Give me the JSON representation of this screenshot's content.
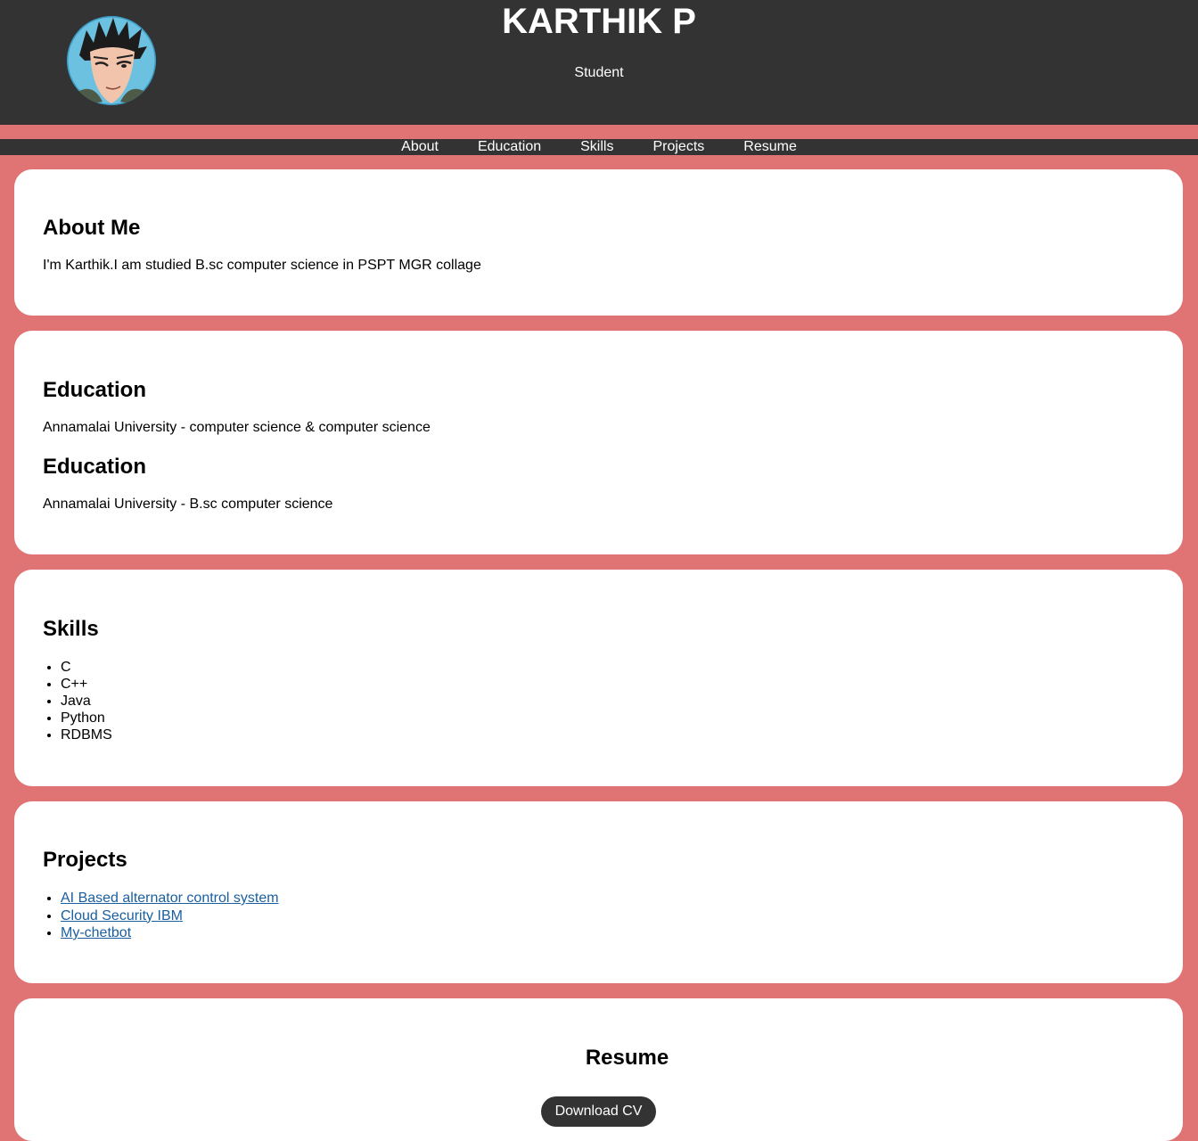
{
  "header": {
    "name": "KARTHIK P",
    "role": "Student",
    "avatar_icon": "anime-character-avatar"
  },
  "nav": {
    "items": [
      "About",
      "Education",
      "Skills",
      "Projects",
      "Resume"
    ]
  },
  "about": {
    "heading": "About Me",
    "text": "I'm Karthik.I am studied B.sc computer science in PSPT MGR collage"
  },
  "education": [
    {
      "heading": "Education",
      "text": "Annamalai University - computer science & computer science"
    },
    {
      "heading": "Education",
      "text": "Annamalai University - B.sc computer science"
    }
  ],
  "skills": {
    "heading": "Skills",
    "items": [
      "C",
      "C++",
      "Java",
      "Python",
      "RDBMS"
    ]
  },
  "projects": {
    "heading": "Projects",
    "items": [
      "AI Based alternator control system",
      "Cloud Security IBM",
      "My-chetbot"
    ]
  },
  "resume": {
    "heading": "Resume",
    "button_label": "Download CV"
  },
  "colors": {
    "background": "#e07474",
    "header": "#333333",
    "card": "#ffffff",
    "link": "#1a5fa0"
  }
}
